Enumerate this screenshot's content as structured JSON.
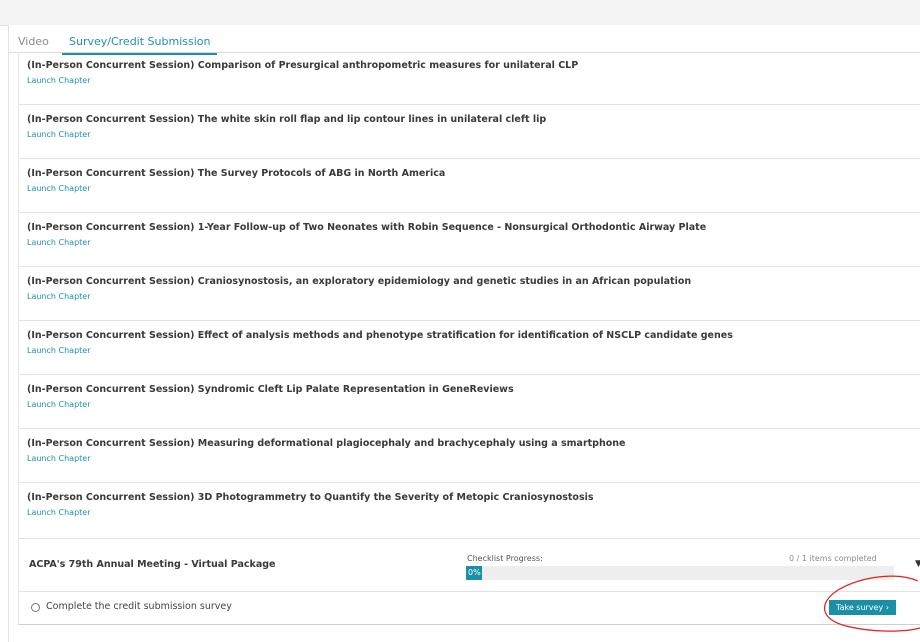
{
  "tabs": [
    {
      "label": "Video"
    },
    {
      "label": "Survey/Credit Submission"
    }
  ],
  "chapters": [
    {
      "title": "(In-Person Concurrent Session) Comparison of Presurgical anthropometric measures for unilateral CLP",
      "link": "Launch Chapter"
    },
    {
      "title": "(In-Person Concurrent Session) The white skin roll flap and lip contour lines in unilateral cleft lip",
      "link": "Launch Chapter"
    },
    {
      "title": "(In-Person Concurrent Session) The Survey Protocols of ABG in North America",
      "link": "Launch Chapter"
    },
    {
      "title": "(In-Person Concurrent Session) 1-Year Follow-up of Two Neonates with Robin Sequence - Nonsurgical Orthodontic Airway Plate",
      "link": "Launch Chapter"
    },
    {
      "title": "(In-Person Concurrent Session) Craniosynostosis, an exploratory epidemiology and genetic studies in an African population",
      "link": "Launch Chapter"
    },
    {
      "title": "(In-Person Concurrent Session) Effect of analysis methods and phenotype stratification for identification of NSCLP candidate genes",
      "link": "Launch Chapter"
    },
    {
      "title": "(In-Person Concurrent Session) Syndromic Cleft Lip Palate Representation in GeneReviews",
      "link": "Launch Chapter"
    },
    {
      "title": "(In-Person Concurrent Session) Measuring deformational plagiocephaly and brachycephaly using a smartphone",
      "link": "Launch Chapter"
    },
    {
      "title": "(In-Person Concurrent Session) 3D Photogrammetry to Quantify the Severity of Metopic Craniosynostosis",
      "link": "Launch Chapter"
    }
  ],
  "package": {
    "title": "ACPA's 79th Annual Meeting - Virtual Package",
    "checklist_label": "Checklist Progress:",
    "checklist_count": "0 / 1 items completed",
    "progress_percent": 0,
    "progress_text": "0%",
    "expand_icon": "caret-down-icon"
  },
  "survey": {
    "item_label": "Complete the credit submission survey",
    "button_label": "Take survey ›",
    "status_icon": "radio-empty-icon"
  },
  "colors": {
    "accent": "#1f8fb0",
    "button": "#1a8fa6",
    "annotation": "#e0201b"
  }
}
